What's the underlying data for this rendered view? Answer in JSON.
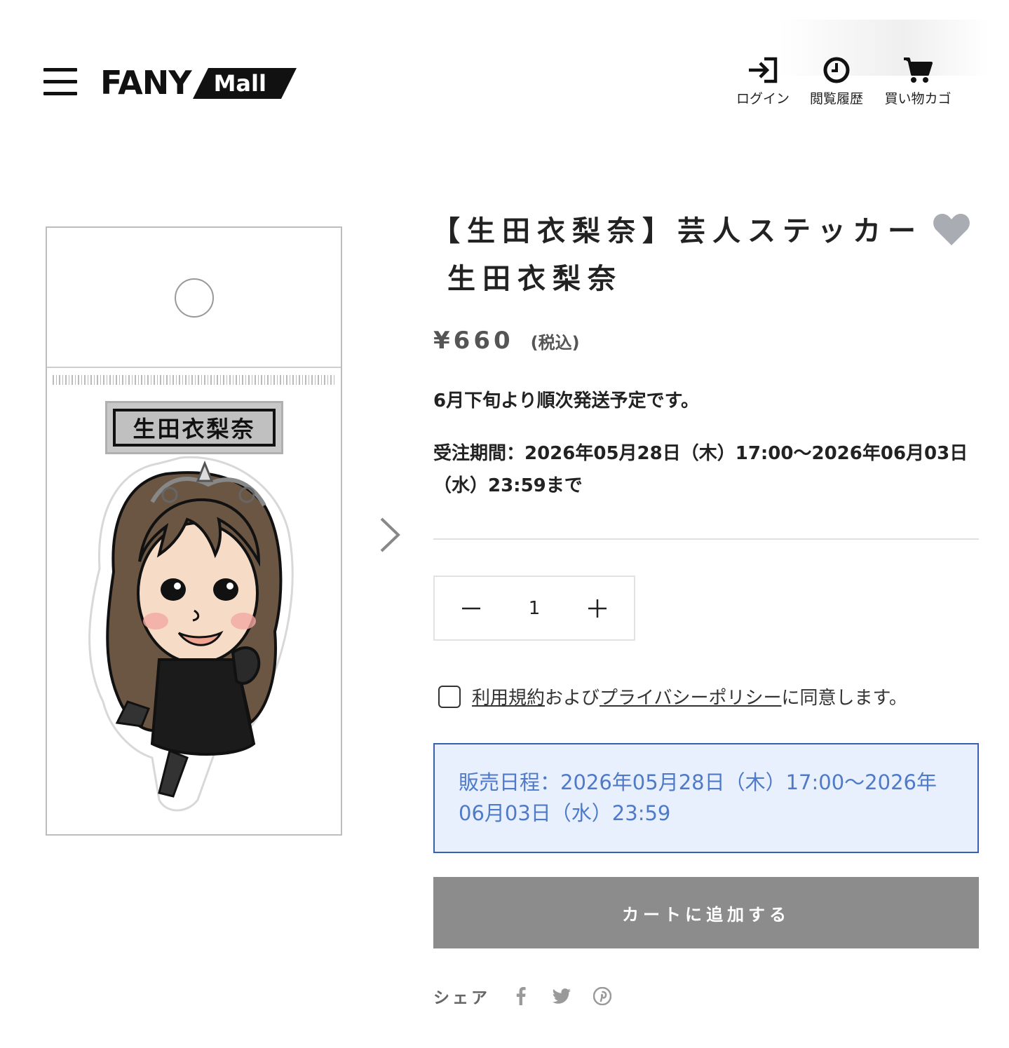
{
  "header": {
    "logo_main": "FANY",
    "logo_sub": "Mall",
    "nav": {
      "login_label": "ログイン",
      "history_label": "閲覧履歴",
      "cart_label": "買い物カゴ"
    }
  },
  "product": {
    "image_name_plate": "生田衣梨奈",
    "title_line1": "【生田衣梨奈】芸人ステッカー",
    "title_line2": "生田衣梨奈",
    "price": "¥660",
    "tax_note": "(税込)",
    "shipping_note": "6月下旬より順次発送予定です。",
    "order_period": "受注期間：2026年05月28日（木）17:00〜2026年06月03日（水）23:59まで",
    "quantity": "1",
    "agreement": {
      "terms_link": "利用規約",
      "and_text": "および",
      "privacy_link": "プライバシーポリシー",
      "suffix": "に同意します。"
    },
    "sale_schedule": "販売日程：2026年05月28日（木）17:00〜2026年06月03日（水）23:59",
    "add_to_cart_label": "カートに追加する",
    "share_label": "シェア",
    "share_icons": [
      "facebook-icon",
      "twitter-icon",
      "pinterest-icon"
    ]
  },
  "colors": {
    "schedule_bg": "#e8f0fd",
    "schedule_text": "#4f7ac8",
    "schedule_border": "#3b5fb0",
    "cart_button": "#8c8c8c",
    "heart": "#a9adb3"
  }
}
